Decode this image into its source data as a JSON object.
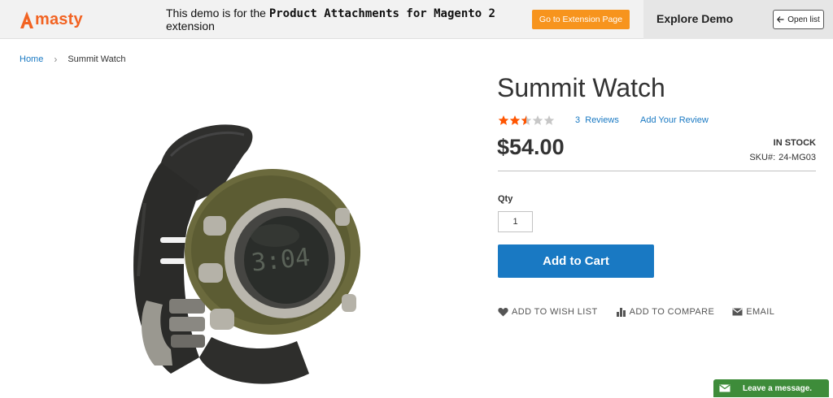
{
  "demo_bar": {
    "logo_text": "masty",
    "notice_prefix": "This demo is for the ",
    "notice_bold": "Product Attachments for Magento 2",
    "notice_suffix": "extension",
    "extension_button": "Go to Extension Page",
    "explore_label": "Explore Demo",
    "open_list_label": "Open list"
  },
  "breadcrumb": {
    "home": "Home",
    "separator": "›",
    "current": "Summit Watch"
  },
  "product": {
    "title": "Summit Watch",
    "rating": {
      "stars_filled": 2.5,
      "stars_total": 5
    },
    "reviews_count": "3",
    "reviews_label": "Reviews",
    "add_review": "Add Your Review",
    "price": "$54.00",
    "stock": "In stock",
    "sku_label": "SKU#:",
    "sku_value": "24-MG03",
    "qty_label": "Qty",
    "qty_value": "1",
    "add_to_cart": "Add to Cart",
    "actions": {
      "wishlist": "Add to Wish List",
      "compare": "Add to Compare",
      "email": "Email"
    }
  },
  "chat": {
    "label": "Leave a message."
  },
  "colors": {
    "brand_orange": "#f26322",
    "button_orange": "#f7941d",
    "link_blue": "#1979c3",
    "star_filled": "#ff5501",
    "star_empty": "#c7c7c7",
    "chat_green": "#3e8c3a"
  }
}
